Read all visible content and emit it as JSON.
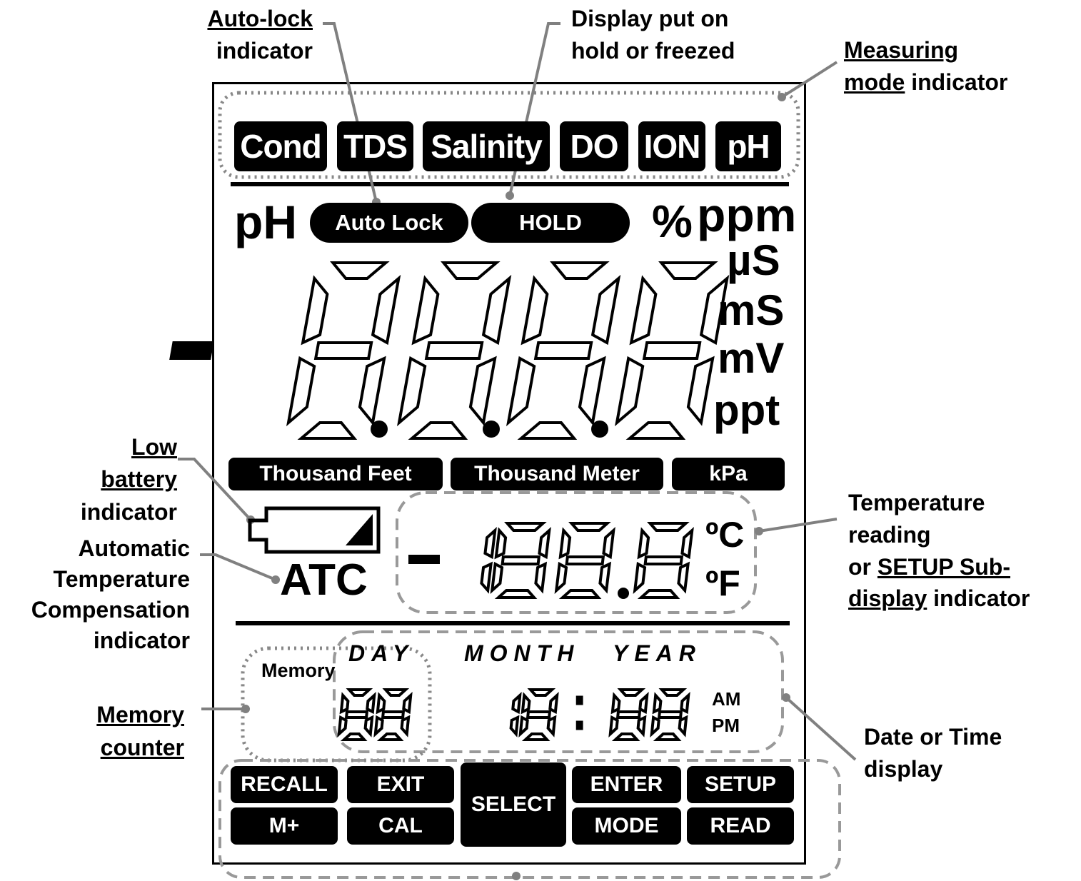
{
  "measuring_modes": [
    "Cond",
    "TDS",
    "Salinity",
    "DO",
    "ION",
    "pH"
  ],
  "indicators": {
    "ph": "pH",
    "auto_lock": "Auto Lock",
    "hold": "HOLD",
    "atc": "ATC"
  },
  "main_display": {
    "sign": "-",
    "digits": "8.8.8.8",
    "units": [
      "%",
      "ppm",
      "µS",
      "mS",
      "mV",
      "ppt"
    ]
  },
  "pressure_units": [
    "Thousand Feet",
    "Thousand Meter",
    "kPa"
  ],
  "temperature_display": {
    "value": "-188.8",
    "units": [
      "ºC",
      "ºF"
    ]
  },
  "date_time": {
    "labels": [
      "DAY",
      "MONTH",
      "YEAR"
    ],
    "memory_label": "Memory",
    "memory_digits": "88",
    "time_hours": "18",
    "separator": ":",
    "time_minutes": "88",
    "am": "AM",
    "pm": "PM"
  },
  "keys": {
    "recall": "RECALL",
    "m_plus": "M+",
    "exit": "EXIT",
    "cal": "CAL",
    "select": "SELECT",
    "enter": "ENTER",
    "mode": "MODE",
    "setup": "SETUP",
    "read": "READ"
  },
  "callouts": {
    "auto_lock": {
      "title": "Auto-lock",
      "rest": "indicator"
    },
    "hold": {
      "line1": "Display put on",
      "line2": "hold or freezed"
    },
    "measuring_mode": {
      "u1": "Measuring",
      "u2": "mode",
      "rest": "indicator"
    },
    "low_battery": {
      "u1": "Low",
      "u2": "battery",
      "rest": "indicator"
    },
    "atc": {
      "line1": "Automatic",
      "line2": "Temperature",
      "line3": "Compensation",
      "line4": "indicator"
    },
    "temperature": {
      "line1": "Temperature",
      "line2": "reading",
      "prefix": "or",
      "u1": "SETUP Sub-",
      "u2": "display",
      "rest": "indicator"
    },
    "memory": {
      "u1": "Memory",
      "u2": "counter"
    },
    "date_time": {
      "line1": "Date or Time",
      "line2": "display"
    }
  }
}
